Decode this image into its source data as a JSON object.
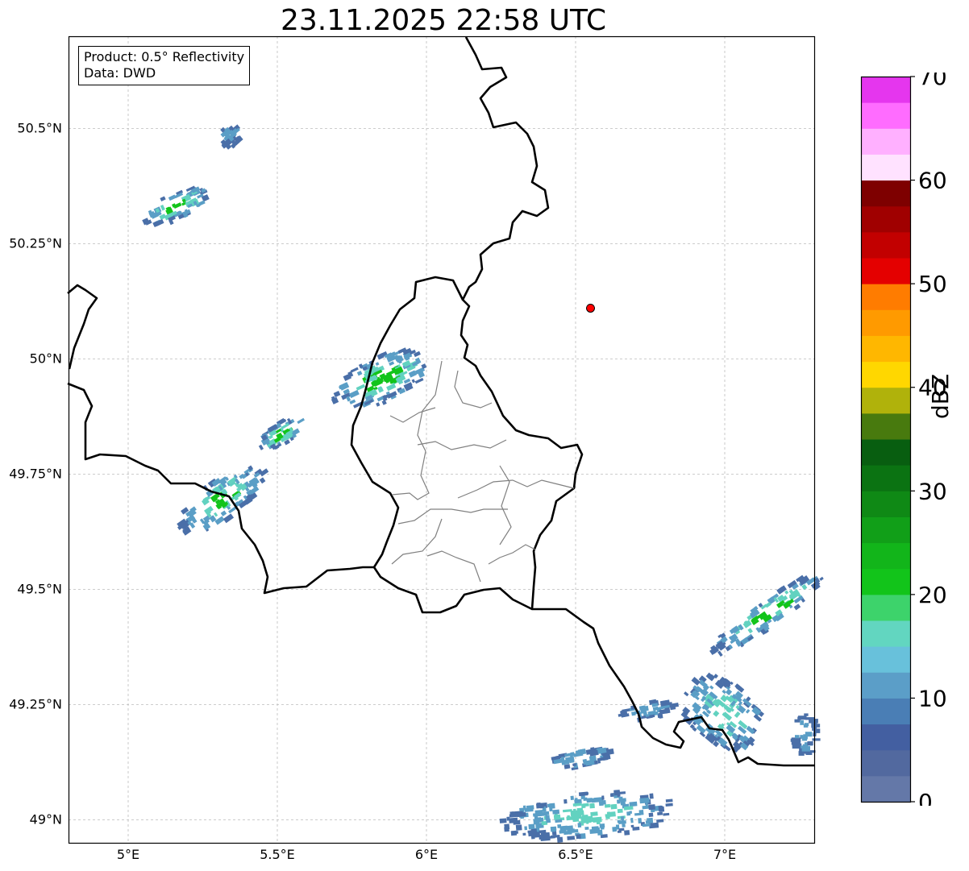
{
  "title": "23.11.2025 22:58 UTC",
  "info_box": {
    "product": "Product: 0.5° Reflectivity",
    "data": "Data: DWD"
  },
  "map": {
    "lon_range": [
      4.8,
      7.3
    ],
    "lat_range": [
      48.95,
      50.7
    ],
    "lat_ticks": [
      {
        "value": 50.5,
        "label": "50.5°N"
      },
      {
        "value": 50.25,
        "label": "50.25°N"
      },
      {
        "value": 50.0,
        "label": "50°N"
      },
      {
        "value": 49.75,
        "label": "49.75°N"
      },
      {
        "value": 49.5,
        "label": "49.5°N"
      },
      {
        "value": 49.25,
        "label": "49.25°N"
      },
      {
        "value": 49.0,
        "label": "49°N"
      }
    ],
    "lon_ticks": [
      {
        "value": 5.0,
        "label": "5°E"
      },
      {
        "value": 5.5,
        "label": "5.5°E"
      },
      {
        "value": 6.0,
        "label": "6°E"
      },
      {
        "value": 6.5,
        "label": "6.5°E"
      },
      {
        "value": 7.0,
        "label": "7°E"
      }
    ],
    "gridlines": true,
    "marker": {
      "lon": 6.55,
      "lat": 50.11,
      "color": "#ff0000"
    },
    "echo_colors": {
      "weak": "#4a6fa8",
      "light": "#5a9ec6",
      "moderate": "#62d2c0",
      "strong": "#12c41a"
    }
  },
  "colorbar": {
    "label": "dBZ",
    "tick_labels": [
      "0",
      "10",
      "20",
      "30",
      "40",
      "50",
      "60",
      "70"
    ],
    "tick_values": [
      0,
      10,
      20,
      30,
      40,
      50,
      60,
      70
    ],
    "min": 0,
    "max": 70,
    "colors": [
      "#6478a8",
      "#52699f",
      "#435fa1",
      "#4a7eb5",
      "#5b9ec8",
      "#68c1db",
      "#62d6c0",
      "#3dd36b",
      "#12c41a",
      "#12b51a",
      "#119f18",
      "#0f8915",
      "#0b7312",
      "#085e10",
      "#487a0e",
      "#b0b20b",
      "#ffd700",
      "#ffb700",
      "#ff9a00",
      "#ff7c00",
      "#e40000",
      "#c20000",
      "#a00000",
      "#7e0000",
      "#ffe2ff",
      "#ffb0ff",
      "#ff6cff",
      "#e536ee"
    ]
  }
}
